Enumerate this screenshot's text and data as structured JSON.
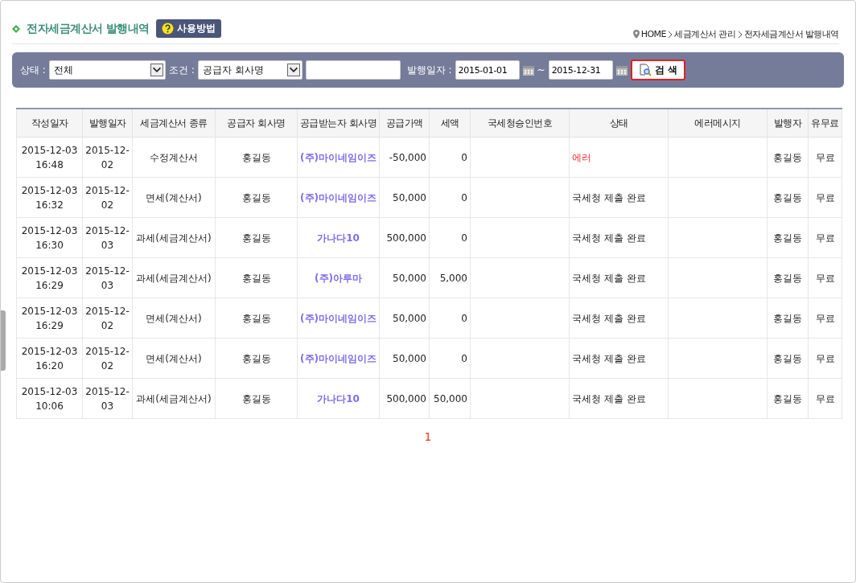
{
  "page_title": "전자세금계산서 발행내역",
  "help_button": "사용방법",
  "breadcrumb": [
    "HOME",
    "세금계산서 관리",
    "전자세금계산서 발행내역"
  ],
  "filters": {
    "status_label": "상태 :",
    "status_value": "전체",
    "condition_label": "조건 :",
    "condition_value": "공급자 회사명",
    "date_label": "발행일자 :",
    "date_from": "2015-01-01",
    "date_sep": "~",
    "date_to": "2015-12-31",
    "search_button": "검 색"
  },
  "table": {
    "columns": [
      "작성일자",
      "발행일자",
      "세금계산서 종류",
      "공급자 회사명",
      "공급받는자 회사명",
      "공급가액",
      "세액",
      "국세청승인번호",
      "상태",
      "에러메시지",
      "발행자",
      "유무료"
    ],
    "rows": [
      {
        "written": "2015-12-03 16:48",
        "issued": "2015-12-02",
        "type": "수정계산서",
        "supplier": "홍길동",
        "buyer": "(주)마이네임이즈",
        "amount": "-50,000",
        "tax": "0",
        "status": "에러",
        "error": true,
        "issuer": "홍길동",
        "fee": "무료"
      },
      {
        "written": "2015-12-03 16:32",
        "issued": "2015-12-02",
        "type": "면세(계산서)",
        "supplier": "홍길동",
        "buyer": "(주)마이네임이즈",
        "amount": "50,000",
        "tax": "0",
        "status": "국세청 제출 완료",
        "error": false,
        "issuer": "홍길동",
        "fee": "무료"
      },
      {
        "written": "2015-12-03 16:30",
        "issued": "2015-12-03",
        "type": "과세(세금계산서)",
        "supplier": "홍길동",
        "buyer": "가나다10",
        "amount": "500,000",
        "tax": "0",
        "status": "국세청 제출 완료",
        "error": false,
        "issuer": "홍길동",
        "fee": "무료"
      },
      {
        "written": "2015-12-03 16:29",
        "issued": "2015-12-03",
        "type": "과세(세금계산서)",
        "supplier": "홍길동",
        "buyer": "(주)아루마",
        "amount": "50,000",
        "tax": "5,000",
        "status": "국세청 제출 완료",
        "error": false,
        "issuer": "홍길동",
        "fee": "무료"
      },
      {
        "written": "2015-12-03 16:29",
        "issued": "2015-12-02",
        "type": "면세(계산서)",
        "supplier": "홍길동",
        "buyer": "(주)마이네임이즈",
        "amount": "50,000",
        "tax": "0",
        "status": "국세청 제출 완료",
        "error": false,
        "issuer": "홍길동",
        "fee": "무료"
      },
      {
        "written": "2015-12-03 16:20",
        "issued": "2015-12-02",
        "type": "면세(계산서)",
        "supplier": "홍길동",
        "buyer": "(주)마이네임이즈",
        "amount": "50,000",
        "tax": "0",
        "status": "국세청 제출 완료",
        "error": false,
        "issuer": "홍길동",
        "fee": "무료"
      },
      {
        "written": "2015-12-03 10:06",
        "issued": "2015-12-03",
        "type": "과세(세금계산서)",
        "supplier": "홍길동",
        "buyer": "가나다10",
        "amount": "500,000",
        "tax": "50,000",
        "status": "국세청 제출 완료",
        "error": false,
        "issuer": "홍길동",
        "fee": "무료"
      }
    ]
  },
  "pagination": [
    {
      "label": "1",
      "selected": true
    }
  ]
}
